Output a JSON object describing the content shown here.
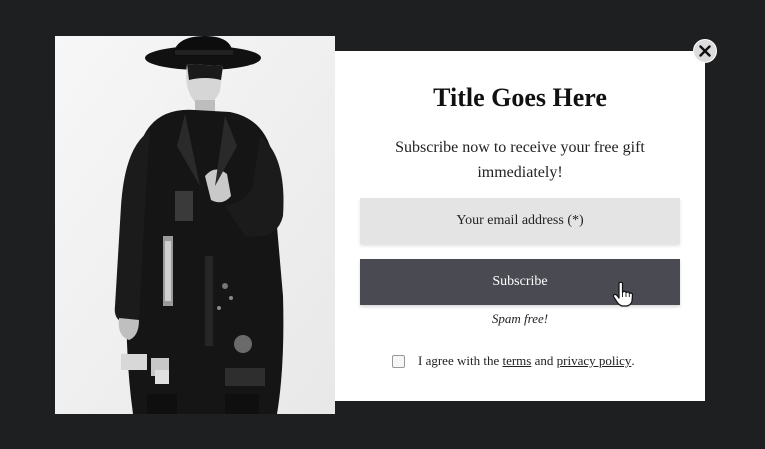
{
  "popup": {
    "title": "Title Goes Here",
    "subtitle": "Subscribe now to receive your free gift immediately!",
    "email_placeholder": "Your email address (*)",
    "subscribe_label": "Subscribe",
    "spam_note": "Spam free!",
    "agree_prefix": "I agree with the ",
    "terms_link": "terms",
    "agree_and": " and ",
    "privacy_link": "privacy policy",
    "agree_suffix": "."
  },
  "icons": {
    "close": "close-icon",
    "cursor": "hand-pointer-icon"
  },
  "colors": {
    "overlay": "#1e1f21",
    "modal_bg": "#ffffff",
    "input_bg": "#e4e4e4",
    "button_bg": "#4a4a52"
  }
}
